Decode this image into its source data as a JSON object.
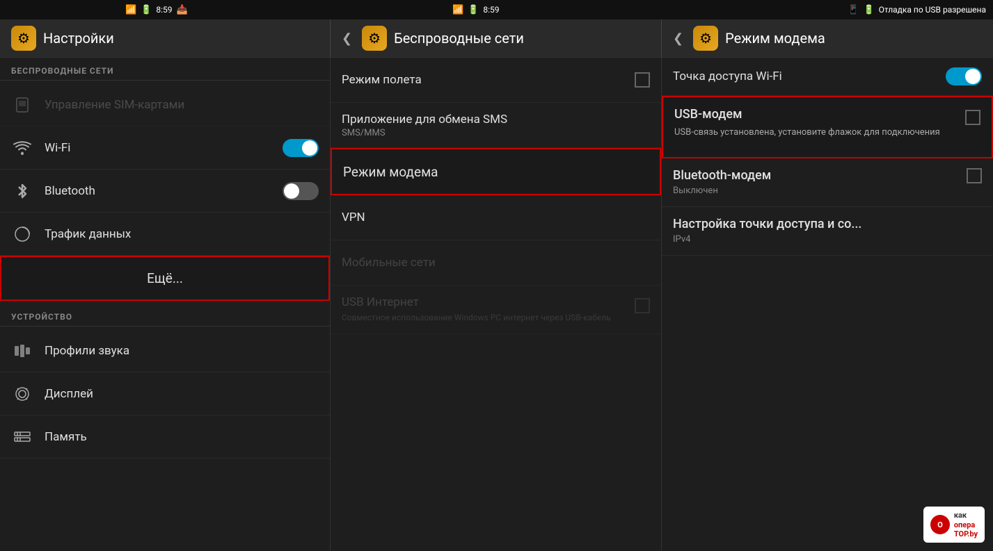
{
  "statusBar": {
    "leftIcons": [
      "wifi",
      "battery",
      "time"
    ],
    "time1": "8:59",
    "time2": "8:59",
    "rightText": "Отладка по USB разрешена",
    "batteryLevel": "100%"
  },
  "panel1": {
    "title": "Настройки",
    "sectionWireless": "БЕСПРОВОДНЫЕ СЕТИ",
    "items": [
      {
        "icon": "sim",
        "label": "Управление SIM-картами",
        "disabled": true
      },
      {
        "icon": "wifi",
        "label": "Wi-Fi",
        "toggle": "on"
      },
      {
        "icon": "bluetooth",
        "label": "Bluetooth",
        "toggle": "off"
      },
      {
        "icon": "data",
        "label": "Трафик данных"
      },
      {
        "icon": "more",
        "label": "Ещё...",
        "selected": true
      }
    ],
    "sectionDevice": "УСТРОЙСТВО",
    "deviceItems": [
      {
        "icon": "sound",
        "label": "Профили звука"
      },
      {
        "icon": "display",
        "label": "Дисплей"
      },
      {
        "icon": "memory",
        "label": "Память"
      }
    ]
  },
  "panel2": {
    "title": "Беспроводные сети",
    "items": [
      {
        "label": "Режим полета",
        "checkbox": true
      },
      {
        "label": "Приложение для обмена SMS",
        "subtitle": "SMS/MMS"
      },
      {
        "label": "Режим модема",
        "selected": true
      },
      {
        "label": "VPN"
      },
      {
        "label": "Мобильные сети",
        "disabled": true
      },
      {
        "label": "USB Интернет",
        "subtitle": "Совместное использование Windows PC интернет через USB-кабель",
        "disabled": true,
        "checkbox": true
      }
    ]
  },
  "panel3": {
    "title": "Режим модема",
    "items": [
      {
        "label": "Точка доступа Wi-Fi",
        "toggle": "on"
      },
      {
        "label": "USB-модем",
        "subtitle": "USB-связь установлена, установите флажок для подключения",
        "checkbox": true,
        "selected": true
      },
      {
        "label": "Bluetooth-модем",
        "subtitle": "Выключен",
        "checkbox": true
      },
      {
        "label": "Настройка точки доступа и со...",
        "subtitle": "IPv4"
      }
    ]
  },
  "watermark": {
    "line1": "как",
    "line2": "опера ТОР.by",
    "icon": "O"
  }
}
